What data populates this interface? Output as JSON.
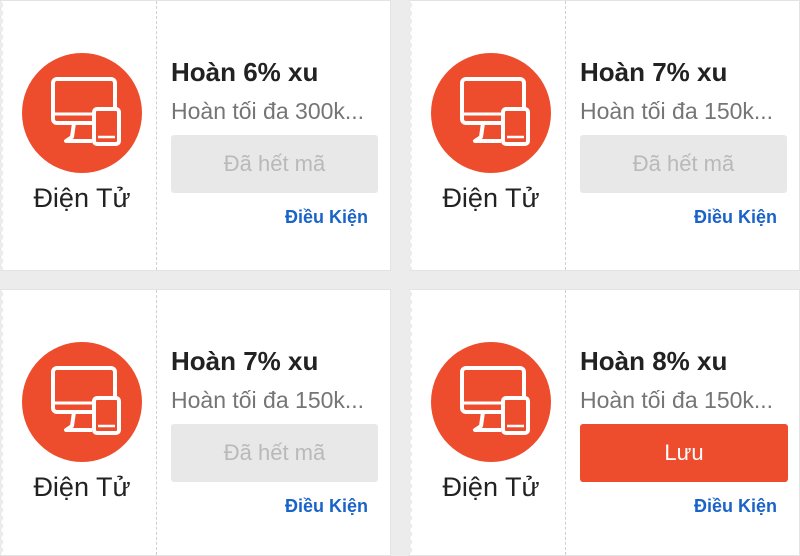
{
  "vouchers": [
    {
      "category_label": "Điện Tử",
      "icon": "electronics-icon",
      "title": "Hoàn 6% xu",
      "description": "Hoàn tối đa 300k...",
      "button_label": "Đã hết mã",
      "button_state": "disabled",
      "conditions_label": "Điều Kiện"
    },
    {
      "category_label": "Điện Tử",
      "icon": "electronics-icon",
      "title": "Hoàn 7% xu",
      "description": "Hoàn tối đa 150k...",
      "button_label": "Đã hết mã",
      "button_state": "disabled",
      "conditions_label": "Điều Kiện"
    },
    {
      "category_label": "Điện Tử",
      "icon": "electronics-icon",
      "title": "Hoàn 7% xu",
      "description": "Hoàn tối đa 150k...",
      "button_label": "Đã hết mã",
      "button_state": "disabled",
      "conditions_label": "Điều Kiện"
    },
    {
      "category_label": "Điện Tử",
      "icon": "electronics-icon",
      "title": "Hoàn 8% xu",
      "description": "Hoàn tối đa 150k...",
      "button_label": "Lưu",
      "button_state": "active",
      "conditions_label": "Điều Kiện"
    }
  ],
  "colors": {
    "accent": "#ee4d2d",
    "link": "#1a63c9",
    "disabled_bg": "#e8e8e8",
    "disabled_text": "#b9b9b9"
  }
}
